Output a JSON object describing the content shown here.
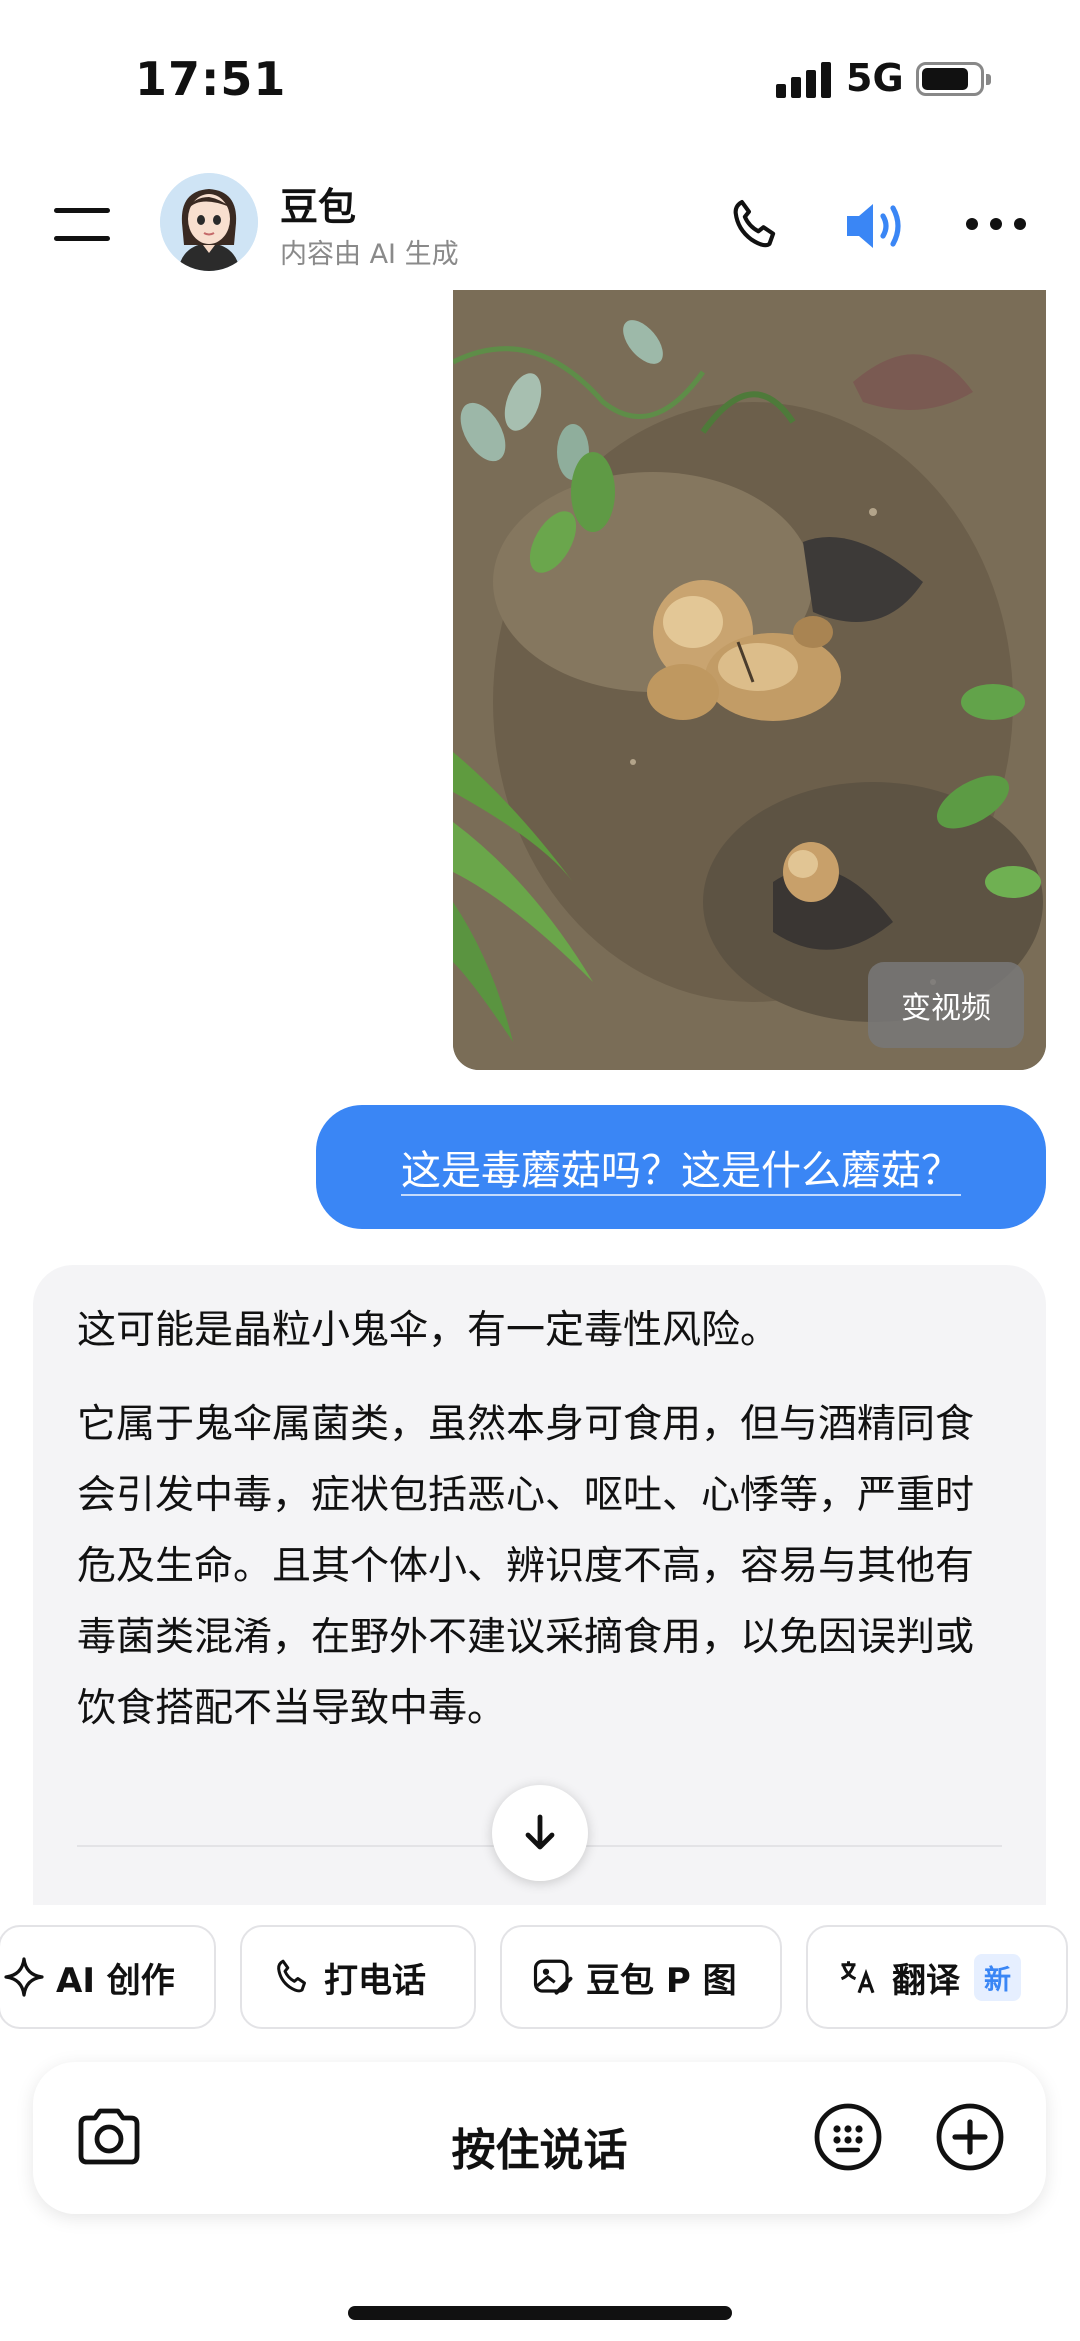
{
  "status_bar": {
    "time": "17:51",
    "network": "5G"
  },
  "header": {
    "bot_name": "豆包",
    "subtitle": "内容由 AI 生成"
  },
  "photo": {
    "video_button_label": "变视频"
  },
  "user_message": "这是毒蘑菇吗？这是什么蘑菇？",
  "ai_message": {
    "paragraph1": "这可能是晶粒小鬼伞，有一定毒性风险。",
    "paragraph2": "它属于鬼伞属菌类，虽然本身可食用，但与酒精同食会引发中毒，症状包括恶心、呕吐、心悸等，严重时危及生命。且其个体小、辨识度不高，容易与其他有毒菌类混淆，在野外不建议采摘食用，以免因误判或饮食搭配不当导致中毒。"
  },
  "chips": [
    {
      "label": "AI 创作",
      "icon": "sparkle-icon"
    },
    {
      "label": "打电话",
      "icon": "phone-icon"
    },
    {
      "label": "豆包 P 图",
      "icon": "image-edit-icon"
    },
    {
      "label": "翻译",
      "icon": "translate-icon",
      "badge": "新"
    }
  ],
  "input_bar": {
    "hold_to_talk": "按住说话"
  },
  "colors": {
    "accent": "#3a86f5",
    "bubble_gray": "#f4f4f6"
  }
}
